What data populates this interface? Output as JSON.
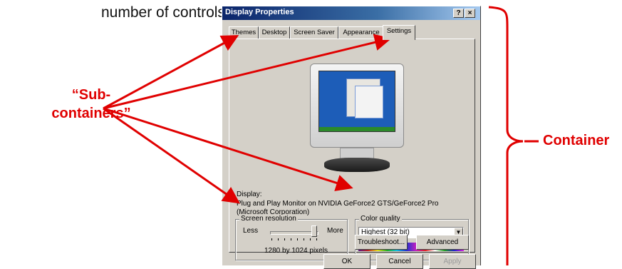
{
  "caption": "number of controls).",
  "annotations": {
    "sub_containers": "“Sub-containers”",
    "container": "Container"
  },
  "dialog": {
    "title": "Display Properties",
    "help_btn": "?",
    "close_btn": "×",
    "tabs": [
      {
        "label": "Themes"
      },
      {
        "label": "Desktop"
      },
      {
        "label": "Screen Saver"
      },
      {
        "label": "Appearance"
      },
      {
        "label": "Settings",
        "active": true
      }
    ],
    "display_label": "Display:",
    "display_desc": "Plug and Play Monitor on NVIDIA GeForce2 GTS/GeForce2 Pro (Microsoft Corporation)",
    "screen_resolution": {
      "label": "Screen resolution",
      "less": "Less",
      "more": "More",
      "value": "1280 by 1024 pixels"
    },
    "color_quality": {
      "label": "Color quality",
      "selected": "Highest (32 bit)"
    },
    "troubleshoot": "Troubleshoot...",
    "advanced": "Advanced",
    "ok": "OK",
    "cancel": "Cancel",
    "apply": "Apply"
  },
  "colors": {
    "annotation": "#e00000",
    "titlebar_start": "#0a246a",
    "dialog_bg": "#d4d0c8"
  }
}
